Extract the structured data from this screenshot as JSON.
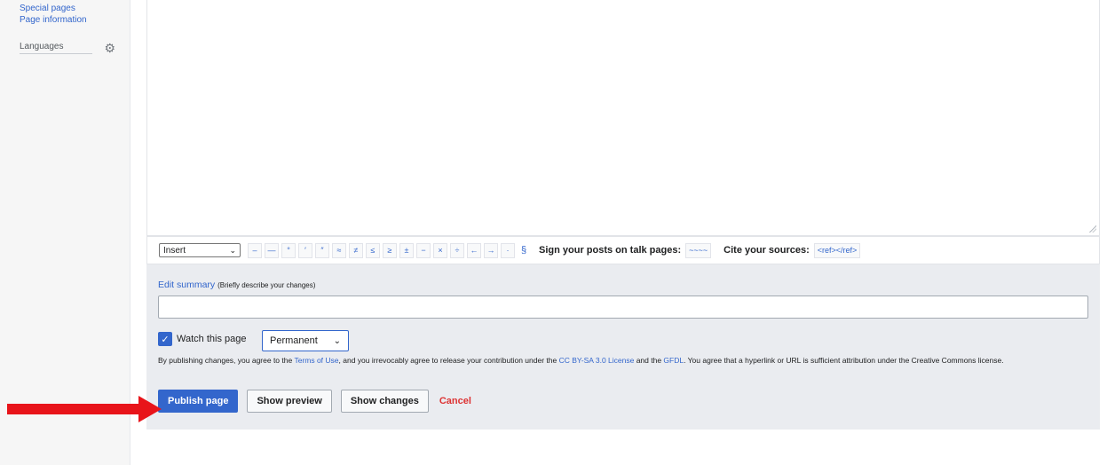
{
  "sidebar": {
    "links": [
      "Special pages",
      "Page information"
    ],
    "languages_label": "Languages",
    "languages_icon": "gear-icon"
  },
  "toolbar": {
    "insert_select": "Insert",
    "chars": [
      "–",
      "—",
      "°",
      "′",
      "″",
      "≈",
      "≠",
      "≤",
      "≥",
      "±",
      "−",
      "×",
      "÷",
      "←",
      "→",
      "·",
      "§"
    ],
    "sign_label": "Sign your posts on talk pages:",
    "sign_value": "~~~~",
    "cite_label": "Cite your sources:",
    "cite_value": "<ref></ref>"
  },
  "summary": {
    "label": "Edit summary",
    "hint": "(Briefly describe your changes)",
    "value": ""
  },
  "watch": {
    "label": "Watch this page",
    "checked": true,
    "period": "Permanent"
  },
  "license": {
    "part1": "By publishing changes, you agree to the ",
    "terms": "Terms of Use",
    "part2": ", and you irrevocably agree to release your contribution under the ",
    "cc": "CC BY-SA 3.0 License",
    "part3": " and the ",
    "gfdl": "GFDL",
    "part4": ". You agree that a hyperlink or URL is sufficient attribution under the Creative Commons license."
  },
  "buttons": {
    "publish": "Publish page",
    "preview": "Show preview",
    "changes": "Show changes",
    "cancel": "Cancel"
  },
  "colors": {
    "accent": "#3366cc",
    "cancel": "#dd3333",
    "arrow": "#e8141a"
  }
}
